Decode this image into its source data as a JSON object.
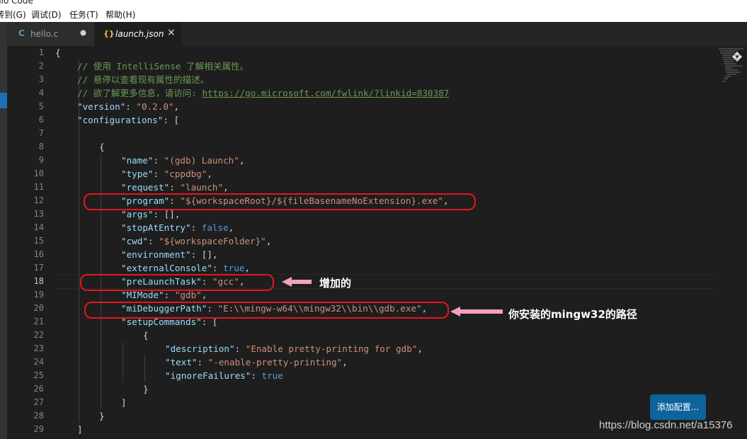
{
  "window": {
    "title_fragment": "dio Code"
  },
  "menu": [
    "转到(G)",
    "调试(D)",
    "任务(T)",
    "帮助(H)"
  ],
  "tabs": [
    {
      "icon": "C",
      "label": "hello.c",
      "modified": true
    },
    {
      "icon": "{}",
      "label": "launch.json",
      "close": "×"
    }
  ],
  "editor": {
    "current_line": 18,
    "lines": [
      {
        "n": 1,
        "indent": 0,
        "tokens": [
          [
            "p",
            "{"
          ]
        ]
      },
      {
        "n": 2,
        "indent": 1,
        "tokens": [
          [
            "c",
            "// 使用 IntelliSense 了解相关属性。"
          ]
        ]
      },
      {
        "n": 3,
        "indent": 1,
        "tokens": [
          [
            "c",
            "// 悬停以查看现有属性的描述。"
          ]
        ]
      },
      {
        "n": 4,
        "indent": 1,
        "tokens": [
          [
            "c",
            "// 欲了解更多信息，请访问: "
          ],
          [
            "cu",
            "https://go.microsoft.com/fwlink/?linkid=830387"
          ]
        ]
      },
      {
        "n": 5,
        "indent": 1,
        "tokens": [
          [
            "k",
            "\"version\""
          ],
          [
            "p",
            ": "
          ],
          [
            "s",
            "\"0.2.0\""
          ],
          [
            "p",
            ","
          ]
        ]
      },
      {
        "n": 6,
        "indent": 1,
        "tokens": [
          [
            "k",
            "\"configurations\""
          ],
          [
            "p",
            ": ["
          ]
        ]
      },
      {
        "n": 7,
        "indent": 1,
        "tokens": []
      },
      {
        "n": 8,
        "indent": 2,
        "tokens": [
          [
            "p",
            "{"
          ]
        ]
      },
      {
        "n": 9,
        "indent": 3,
        "tokens": [
          [
            "k",
            "\"name\""
          ],
          [
            "p",
            ": "
          ],
          [
            "s",
            "\"(gdb) Launch\""
          ],
          [
            "p",
            ","
          ]
        ]
      },
      {
        "n": 10,
        "indent": 3,
        "tokens": [
          [
            "k",
            "\"type\""
          ],
          [
            "p",
            ": "
          ],
          [
            "s",
            "\"cppdbg\""
          ],
          [
            "p",
            ","
          ]
        ]
      },
      {
        "n": 11,
        "indent": 3,
        "tokens": [
          [
            "k",
            "\"request\""
          ],
          [
            "p",
            ": "
          ],
          [
            "s",
            "\"launch\""
          ],
          [
            "p",
            ","
          ]
        ]
      },
      {
        "n": 12,
        "indent": 3,
        "tokens": [
          [
            "k",
            "\"program\""
          ],
          [
            "p",
            ": "
          ],
          [
            "s",
            "\"${workspaceRoot}/${fileBasenameNoExtension}.exe\""
          ],
          [
            "p",
            ","
          ]
        ]
      },
      {
        "n": 13,
        "indent": 3,
        "tokens": [
          [
            "k",
            "\"args\""
          ],
          [
            "p",
            ": [],"
          ]
        ]
      },
      {
        "n": 14,
        "indent": 3,
        "tokens": [
          [
            "k",
            "\"stopAtEntry\""
          ],
          [
            "p",
            ": "
          ],
          [
            "b",
            "false"
          ],
          [
            "p",
            ","
          ]
        ]
      },
      {
        "n": 15,
        "indent": 3,
        "tokens": [
          [
            "k",
            "\"cwd\""
          ],
          [
            "p",
            ": "
          ],
          [
            "s",
            "\"${workspaceFolder}\""
          ],
          [
            "p",
            ","
          ]
        ]
      },
      {
        "n": 16,
        "indent": 3,
        "tokens": [
          [
            "k",
            "\"environment\""
          ],
          [
            "p",
            ": [],"
          ]
        ]
      },
      {
        "n": 17,
        "indent": 3,
        "tokens": [
          [
            "k",
            "\"externalConsole\""
          ],
          [
            "p",
            ": "
          ],
          [
            "b",
            "true"
          ],
          [
            "p",
            ","
          ]
        ]
      },
      {
        "n": 18,
        "indent": 3,
        "tokens": [
          [
            "k",
            "\"preLaunchTask\""
          ],
          [
            "p",
            ": "
          ],
          [
            "s",
            "\"gcc\""
          ],
          [
            "p",
            ","
          ]
        ]
      },
      {
        "n": 19,
        "indent": 3,
        "tokens": [
          [
            "k",
            "\"MIMode\""
          ],
          [
            "p",
            ": "
          ],
          [
            "s",
            "\"gdb\""
          ],
          [
            "p",
            ","
          ]
        ]
      },
      {
        "n": 20,
        "indent": 3,
        "tokens": [
          [
            "k",
            "\"miDebuggerPath\""
          ],
          [
            "p",
            ": "
          ],
          [
            "s",
            "\"E:\\\\mingw-w64\\\\mingw32\\\\bin\\\\gdb.exe\""
          ],
          [
            "p",
            ","
          ]
        ]
      },
      {
        "n": 21,
        "indent": 3,
        "tokens": [
          [
            "k",
            "\"setupCommands\""
          ],
          [
            "p",
            ": ["
          ]
        ]
      },
      {
        "n": 22,
        "indent": 4,
        "tokens": [
          [
            "p",
            "{"
          ]
        ]
      },
      {
        "n": 23,
        "indent": 5,
        "tokens": [
          [
            "k",
            "\"description\""
          ],
          [
            "p",
            ": "
          ],
          [
            "s",
            "\"Enable pretty-printing for gdb\""
          ],
          [
            "p",
            ","
          ]
        ]
      },
      {
        "n": 24,
        "indent": 5,
        "tokens": [
          [
            "k",
            "\"text\""
          ],
          [
            "p",
            ": "
          ],
          [
            "s",
            "\"-enable-pretty-printing\""
          ],
          [
            "p",
            ","
          ]
        ]
      },
      {
        "n": 25,
        "indent": 5,
        "tokens": [
          [
            "k",
            "\"ignoreFailures\""
          ],
          [
            "p",
            ": "
          ],
          [
            "b",
            "true"
          ]
        ]
      },
      {
        "n": 26,
        "indent": 4,
        "tokens": [
          [
            "p",
            "}"
          ]
        ]
      },
      {
        "n": 27,
        "indent": 3,
        "tokens": [
          [
            "p",
            "]"
          ]
        ]
      },
      {
        "n": 28,
        "indent": 2,
        "tokens": [
          [
            "p",
            "}"
          ]
        ]
      },
      {
        "n": 29,
        "indent": 1,
        "tokens": [
          [
            "p",
            "]"
          ]
        ]
      }
    ]
  },
  "annotations": {
    "added": "增加的",
    "mingw_path": "你安装的mingw32的路径"
  },
  "add_config_button": "添加配置...",
  "watermark": "https://blog.csdn.net/a15376",
  "colors": {
    "background": "#1e1e1e",
    "comment": "#6a9955",
    "key": "#9cdcfe",
    "string": "#ce9178",
    "keyword": "#569cd6",
    "highlight_oval": "#e8141e",
    "arrow": "#f4a0c0",
    "button": "#0e639c"
  }
}
